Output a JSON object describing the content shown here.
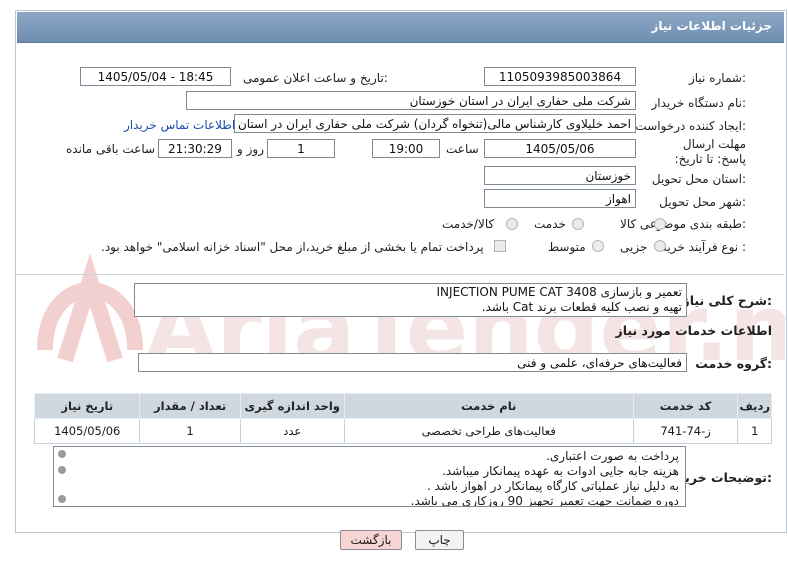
{
  "header": {
    "title": "جزئیات اطلاعات نیاز"
  },
  "fields": {
    "need_number_label": "شماره نیاز:",
    "need_number": "1105093985003864",
    "announce_label": "تاریخ و ساعت اعلان عمومی:",
    "announce_value": "1405/05/04 - 18:45",
    "buyer_org_label": "نام دستگاه خریدار:",
    "buyer_org": "شرکت ملی حفاری ایران در استان خوزستان",
    "creator_label": "ایجاد کننده درخواست:",
    "creator": "احمد خلیلاوی کارشناس مالی(تنخواه گردان) شرکت ملی حفاری ایران در استان",
    "contact_link": "اطلاعات تماس خریدار",
    "deadline_label": "مهلت ارسال پاسخ: تا تاریخ:",
    "deadline_date": "1405/05/06",
    "time_label": "ساعت",
    "deadline_time": "19:00",
    "days_value": "1",
    "days_label": "روز و",
    "remaining_time": "21:30:29",
    "remaining_label": "ساعت باقی مانده",
    "province_label": "استان محل تحویل:",
    "province": "خوزستان",
    "city_label": "شهر محل تحویل:",
    "city": "اهواز",
    "category_label": "طبقه بندی موضوعی:",
    "category_options": [
      "کالا",
      "خدمت",
      "کالا/خدمت"
    ],
    "purchase_type_label": "نوع فرآیند خرید :",
    "purchase_options": [
      "جزیی",
      "متوسط"
    ],
    "payment_note": "پرداخت تمام یا بخشی از مبلغ خرید،از محل \"اسناد خزانه اسلامی\" خواهد بود."
  },
  "summary": {
    "label": "شرح کلی نیاز:",
    "line1": "تعمیر و بازسازی INJECTION PUME CAT 3408",
    "line2": "تهیه و نصب کلیه قطعات برند Cat باشد."
  },
  "services": {
    "section_title": "اطلاعات خدمات مورد نیاز",
    "group_label": "گروه خدمت:",
    "group_value": "فعالیت‌های حرفه‌ای، علمی و فنی",
    "columns": [
      "ردیف",
      "کد خدمت",
      "نام خدمت",
      "واحد اندازه گیری",
      "تعداد / مقدار",
      "تاریخ نیاز"
    ],
    "rows": [
      {
        "row": "1",
        "code": "ز-74-741",
        "name": "فعالیت‌های طراحی تخصصی",
        "unit": "عدد",
        "qty": "1",
        "date": "1405/05/06"
      }
    ]
  },
  "buyer_notes": {
    "label": "توضیحات خریدار:",
    "lines": [
      "پرداخت به صورت اعتباری.",
      "هزینه جابه جایی ادوات به عهده پیمانکار میباشد.",
      "به دلیل نیاز عملیاتی کارگاه پیمانکار در اهواز باشد .",
      "دوره ضمانت جهت تعمیر تجهیز  90 روزکاری می باشد."
    ]
  },
  "buttons": {
    "print": "چاپ",
    "back": "بازگشت"
  },
  "watermark": {
    "text": "AriaTender.neT"
  },
  "colors": {
    "title_bar": "#7a97b8",
    "link": "#1a4fb0",
    "back_button": "#f7d5d5"
  }
}
